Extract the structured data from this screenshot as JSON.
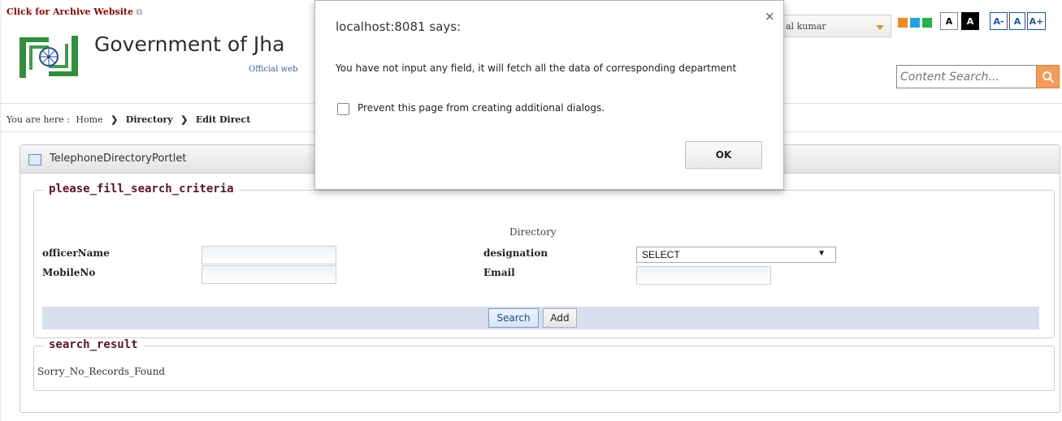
{
  "header": {
    "archive_link": "Click for Archive Website",
    "title": "Government of Jha",
    "subtitle": "Official web",
    "user_select": "al kumar",
    "font_buttons": [
      "A",
      "A",
      "A-",
      "A",
      "A+"
    ],
    "search_placeholder": "Content Search...",
    "theme_colors": [
      "#f08a24",
      "#1fa3e0",
      "#23b34a"
    ]
  },
  "breadcrumb": {
    "prefix": "You are here :",
    "home": "Home",
    "directory": "Directory",
    "edit": "Edit Direct"
  },
  "portlet": {
    "title": "TelephoneDirectoryPortlet",
    "criteria_legend": "please_fill_search_criteria",
    "caption": "Directory",
    "fields": {
      "officer_name_label": "officerName",
      "mobile_label": "MobileNo",
      "designation_label": "designation",
      "designation_value": "SELECT",
      "email_label": "Email"
    },
    "buttons": {
      "search": "Search",
      "add": "Add"
    },
    "results_legend": "search_result",
    "no_records": "Sorry_No_Records_Found"
  },
  "dialog": {
    "title": "localhost:8081 says:",
    "message": "You have not input any field, it will fetch all the data of corresponding department",
    "checkbox_label": "Prevent this page from creating additional dialogs.",
    "ok_label": "OK",
    "close_glyph": "×"
  }
}
